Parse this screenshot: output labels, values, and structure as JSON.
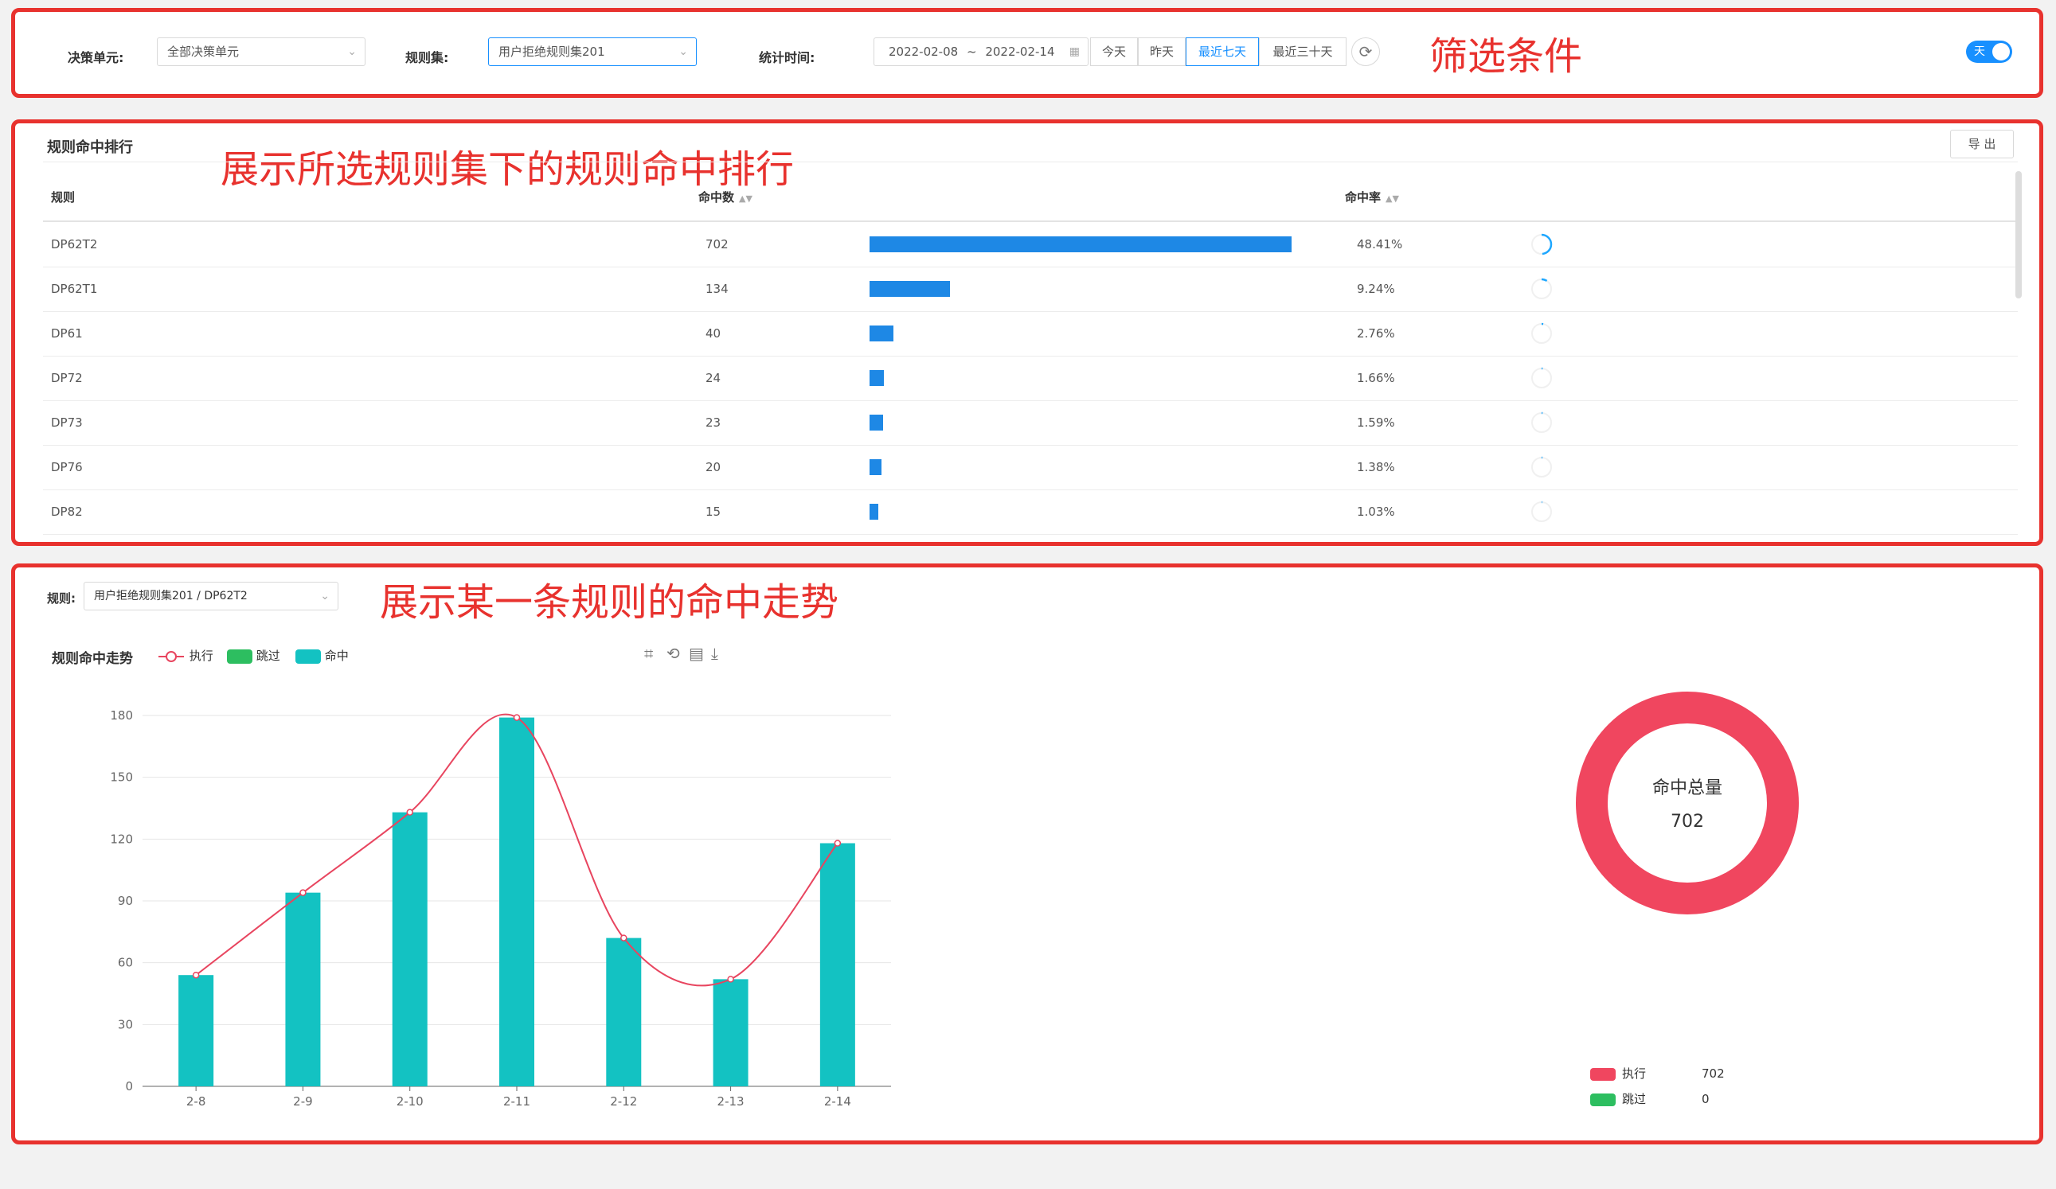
{
  "filters": {
    "unit_label": "决策单元:",
    "unit_value": "全部决策单元",
    "ruleset_label": "规则集:",
    "ruleset_value": "用户拒绝规则集201",
    "time_label": "统计时间:",
    "date_start": "2022-02-08",
    "date_sep": "~",
    "date_end": "2022-02-14",
    "quick": [
      "今天",
      "昨天",
      "最近七天",
      "最近三十天"
    ],
    "quick_selected": "最近七天",
    "toggle_label": "天"
  },
  "annotations": {
    "filter": "筛选条件",
    "ranking": "展示所选规则集下的规则命中排行",
    "trend": "展示某一条规则的命中走势"
  },
  "ranking": {
    "title": "规则命中排行",
    "export_label": "导 出",
    "headers": {
      "rule": "规则",
      "hits": "命中数",
      "rate": "命中率"
    },
    "bar_color": "#1e88e5",
    "ring_color": "#1ea7ff",
    "rows": [
      {
        "rule": "DP62T2",
        "hits": "702",
        "rate": "48.41%",
        "value": 702,
        "ratio": 0.4841
      },
      {
        "rule": "DP62T1",
        "hits": "134",
        "rate": "9.24%",
        "value": 134,
        "ratio": 0.0924
      },
      {
        "rule": "DP61",
        "hits": "40",
        "rate": "2.76%",
        "value": 40,
        "ratio": 0.0276
      },
      {
        "rule": "DP72",
        "hits": "24",
        "rate": "1.66%",
        "value": 24,
        "ratio": 0.0166
      },
      {
        "rule": "DP73",
        "hits": "23",
        "rate": "1.59%",
        "value": 23,
        "ratio": 0.0159
      },
      {
        "rule": "DP76",
        "hits": "20",
        "rate": "1.38%",
        "value": 20,
        "ratio": 0.0138
      },
      {
        "rule": "DP82",
        "hits": "15",
        "rate": "1.03%",
        "value": 15,
        "ratio": 0.0103
      }
    ]
  },
  "trend": {
    "rule_label": "规则:",
    "rule_value": "用户拒绝规则集201 / DP62T2",
    "tools": [
      "crop-icon",
      "restore-icon",
      "data-view-icon",
      "download-icon"
    ]
  },
  "chart_data": [
    {
      "type": "bar",
      "title": "规则命中走势",
      "categories": [
        "2-8",
        "2-9",
        "2-10",
        "2-11",
        "2-12",
        "2-13",
        "2-14"
      ],
      "series": [
        {
          "name": "执行",
          "type": "line",
          "values": [
            54,
            94,
            133,
            179,
            72,
            52,
            118
          ],
          "color": "#e8455f"
        },
        {
          "name": "跳过",
          "type": "bar",
          "values": [
            0,
            0,
            0,
            0,
            0,
            0,
            0
          ],
          "color": "#2dbe60"
        },
        {
          "name": "命中",
          "type": "bar",
          "values": [
            54,
            94,
            133,
            179,
            72,
            52,
            118
          ],
          "color": "#13c2c2"
        }
      ],
      "yticks": [
        "0",
        "30",
        "60",
        "90",
        "120",
        "150",
        "180"
      ],
      "ylim": [
        0,
        180
      ],
      "grid": true,
      "legend": "top-left"
    },
    {
      "type": "pie",
      "center_label": "命中总量",
      "center_value": "702",
      "slices": [
        {
          "name": "执行",
          "value": 702,
          "label": "702",
          "color": "#f0465f"
        },
        {
          "name": "跳过",
          "value": 0,
          "label": "0",
          "color": "#2dbe60"
        }
      ],
      "legend": "bottom-right"
    }
  ]
}
